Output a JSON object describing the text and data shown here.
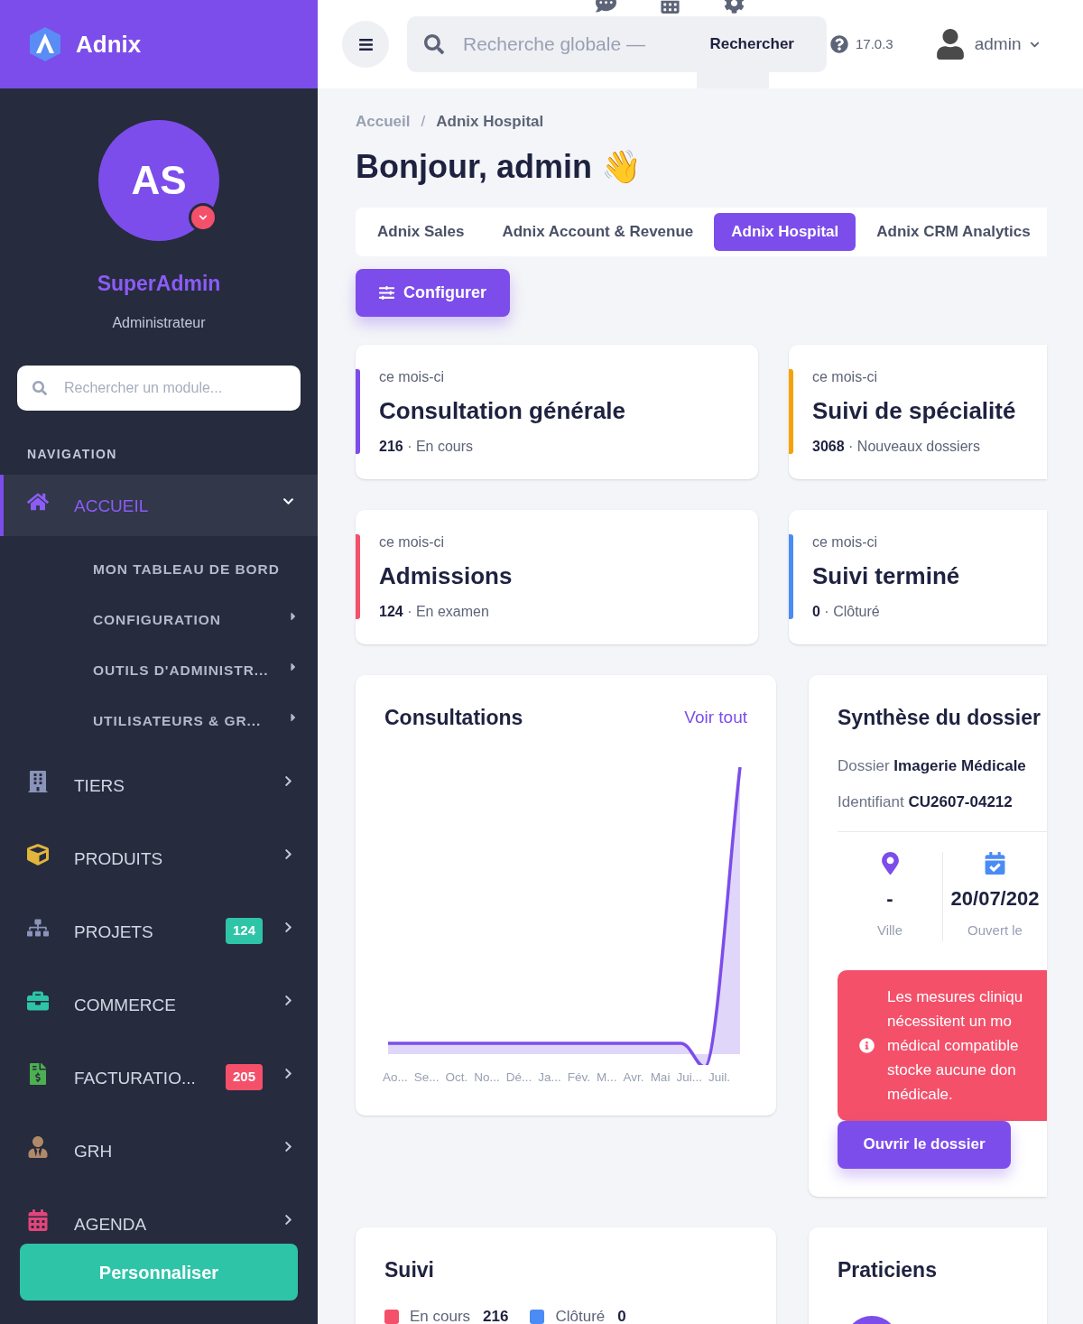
{
  "brand": {
    "name": "Adnix"
  },
  "profile": {
    "initials": "AS",
    "name": "SuperAdmin",
    "role": "Administrateur"
  },
  "module_search": {
    "placeholder": "Rechercher un module..."
  },
  "nav_heading": "NAVIGATION",
  "nav": [
    {
      "label": "ACCUEIL",
      "selected": true,
      "expanded": true,
      "children": [
        {
          "label": "MON TABLEAU DE BORD",
          "has_submenu": false
        },
        {
          "label": "CONFIGURATION",
          "has_submenu": true
        },
        {
          "label": "OUTILS D'ADMINISTR...",
          "has_submenu": true
        },
        {
          "label": "UTILISATEURS & GR...",
          "has_submenu": true
        }
      ]
    },
    {
      "label": "TIERS",
      "selected": false,
      "expanded": false
    },
    {
      "label": "PRODUITS",
      "selected": false,
      "expanded": false
    },
    {
      "label": "PROJETS",
      "selected": false,
      "expanded": false,
      "badge": "124",
      "color": "#2ec4a8"
    },
    {
      "label": "COMMERCE",
      "selected": false,
      "expanded": false
    },
    {
      "label": "FACTURATIO...",
      "selected": false,
      "expanded": false,
      "badge": "205",
      "color": "#f4506a"
    },
    {
      "label": "GRH",
      "selected": false,
      "expanded": false
    },
    {
      "label": "AGENDA",
      "selected": false,
      "expanded": false
    }
  ],
  "customize_button": "Personnaliser",
  "topbar": {
    "search_placeholder": "Recherche globale —",
    "search_button": "Rechercher",
    "version": "17.0.3",
    "user": "admin"
  },
  "breadcrumb": [
    "Accueil",
    "Adnix Hospital"
  ],
  "breadcrumb_separator": "/",
  "greeting": "Bonjour, admin 👋",
  "tabs": [
    {
      "label": "Adnix Sales",
      "selected": false
    },
    {
      "label": "Adnix Account & Revenue",
      "selected": false
    },
    {
      "label": "Adnix Hospital",
      "selected": true
    },
    {
      "label": "Adnix CRM Analytics",
      "selected": false
    }
  ],
  "configure_button": "Configurer",
  "stats": [
    {
      "period": "ce mois-ci",
      "title": "Consultation générale",
      "count": "216",
      "separator": "·",
      "status": "En cours",
      "color": "#7c4dea"
    },
    {
      "period": "ce mois-ci",
      "title": "Suivi de spécialité",
      "count": "3068",
      "separator": "·",
      "status": "Nouveaux dossiers",
      "color": "#f5a20a"
    },
    {
      "period": "ce mois-ci",
      "title": "Admissions",
      "count": "124",
      "separator": "·",
      "status": "En examen",
      "color": "#f4506a"
    },
    {
      "period": "ce mois-ci",
      "title": "Suivi terminé",
      "count": "0",
      "separator": "·",
      "status": "Clôturé",
      "color": "#4b8bf5"
    }
  ],
  "consultations": {
    "title": "Consultations",
    "link": "Voir tout",
    "x_labels": [
      "Ao...",
      "Se...",
      "Oct.",
      "No...",
      "Dé...",
      "Ja...",
      "Fév.",
      "M...",
      "Avr.",
      "Mai",
      "Jui...",
      "Juil."
    ]
  },
  "summary": {
    "title": "Synthèse du dossier",
    "file_label": "Dossier",
    "file_value": "Imagerie Médicale",
    "id_label": "Identifiant",
    "id_value": "CU2607-04212",
    "facts": [
      {
        "value": "-",
        "label": "Ville"
      },
      {
        "value": "20/07/202",
        "label": "Ouvert le"
      }
    ],
    "alert_lines": [
      "Les mesures cliniqu",
      "nécessitent un mo",
      "médical compatible",
      "stocke aucune don",
      "médicale."
    ],
    "button": "Ouvrir le dossier"
  },
  "followup": {
    "title": "Suivi",
    "legend": [
      {
        "label": "En cours",
        "value": "216",
        "color": "#f4506a"
      },
      {
        "label": "Clôturé",
        "value": "0",
        "color": "#4b8bf5"
      }
    ]
  },
  "practitioners": {
    "title": "Praticiens"
  }
}
